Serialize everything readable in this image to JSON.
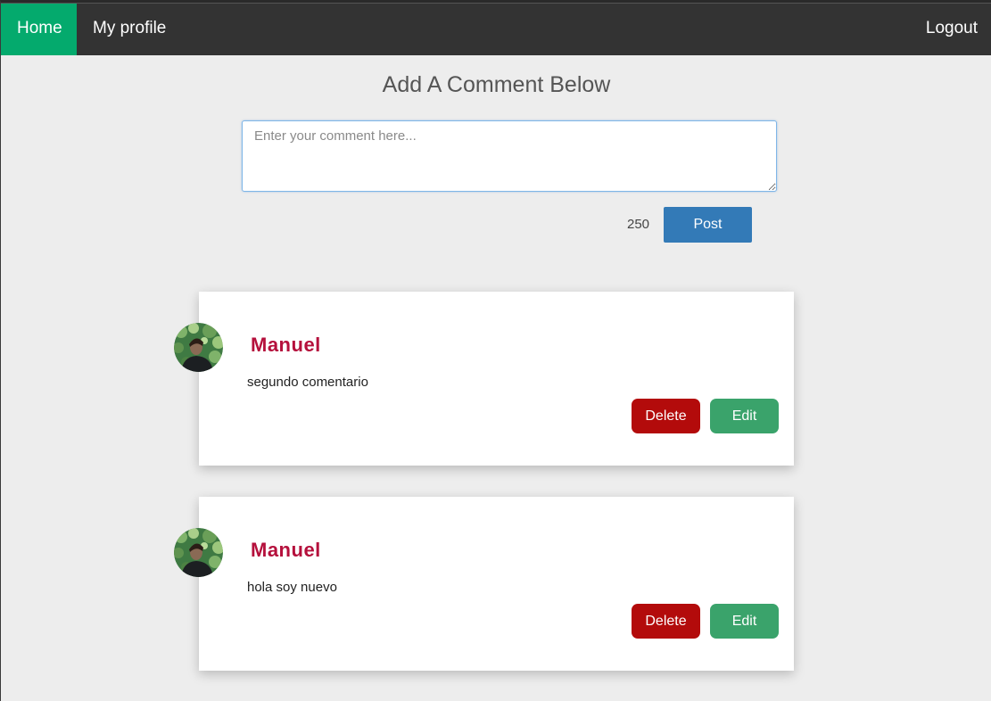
{
  "nav": {
    "home": "Home",
    "profile": "My profile",
    "logout": "Logout"
  },
  "heading": "Add A Comment Below",
  "comment_form": {
    "placeholder": "Enter your comment here...",
    "value": "",
    "char_count": "250",
    "post_label": "Post"
  },
  "comments": [
    {
      "author": "Manuel",
      "text": "segundo comentario",
      "delete_label": "Delete",
      "edit_label": "Edit"
    },
    {
      "author": "Manuel",
      "text": "hola soy nuevo",
      "delete_label": "Delete",
      "edit_label": "Edit"
    }
  ],
  "colors": {
    "nav_bg": "#333333",
    "nav_active": "#04aa6d",
    "post_button": "#337ab7",
    "author_name": "#b5103c",
    "delete_button": "#b30b0b",
    "edit_button": "#3aa36b"
  }
}
